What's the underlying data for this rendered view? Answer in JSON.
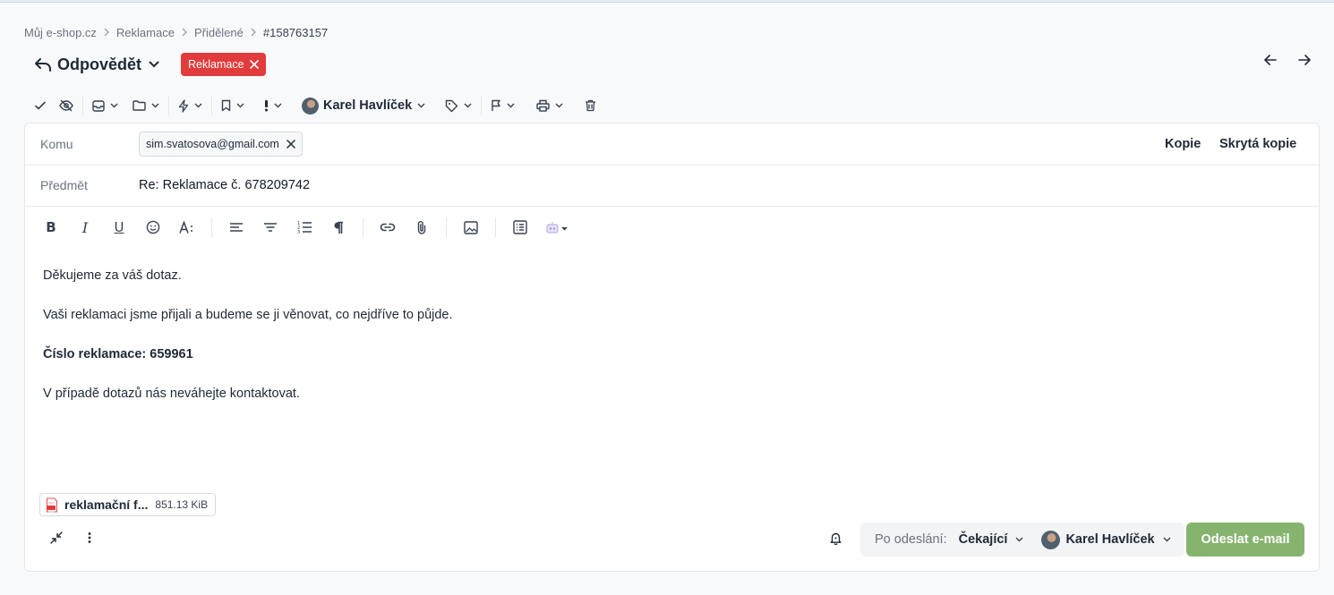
{
  "breadcrumb": {
    "items": [
      "Můj e-shop.cz",
      "Reklamace",
      "Přidělené"
    ],
    "current": "#158763157"
  },
  "header": {
    "reply_label": "Odpovědět",
    "tag_label": "Reklamace",
    "tag_color": "#e23b3b"
  },
  "toolbar": {
    "assignee": "Karel Havlíček",
    "icons": [
      "check-icon",
      "eye-off-icon",
      "inbox-icon",
      "folder-icon",
      "bolt-icon",
      "bookmark-icon",
      "exclamation-icon",
      "tag-icon",
      "flag-icon",
      "printer-icon",
      "trash-icon"
    ]
  },
  "compose": {
    "to_label": "Komu",
    "to_recipient": "sim.svatosova@gmail.com",
    "cc_label": "Kopie",
    "bcc_label": "Skrytá kopie",
    "subject_label": "Předmět",
    "subject_value": "Re: Reklamace č. 678209742"
  },
  "body": {
    "line1": "Děkujeme za váš dotaz.",
    "line2": "Vaši reklamaci jsme přijali a budeme se ji věnovat, co nejdříve to půjde.",
    "line3": "Číslo reklamace: 659961",
    "line4": "V případě dotazů nás neváhejte kontaktovat."
  },
  "attachment": {
    "name": "reklamační f...",
    "size": "851.13 KiB"
  },
  "footer": {
    "after_send_label": "Po odeslání:",
    "after_send_status": "Čekající",
    "after_send_user": "Karel Havlíček",
    "send_label": "Odeslat e-mail",
    "send_color": "#86b46f"
  }
}
